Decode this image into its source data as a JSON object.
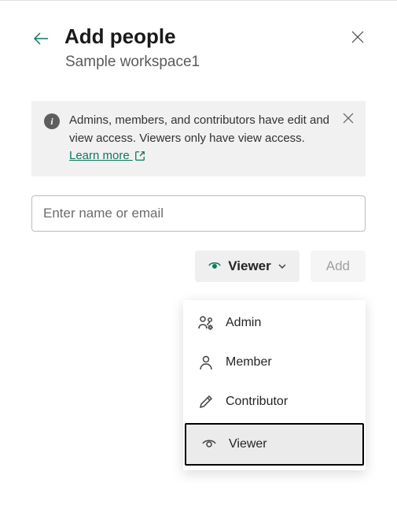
{
  "header": {
    "title": "Add people",
    "subtitle": "Sample workspace1"
  },
  "info": {
    "text_before_link": "Admins, members, and contributors have edit and view access. Viewers only have view access. ",
    "link_text": "Learn more "
  },
  "input": {
    "placeholder": "Enter name or email"
  },
  "actions": {
    "role_selected": "Viewer",
    "add_label": "Add"
  },
  "roles": {
    "admin": "Admin",
    "member": "Member",
    "contributor": "Contributor",
    "viewer": "Viewer"
  }
}
